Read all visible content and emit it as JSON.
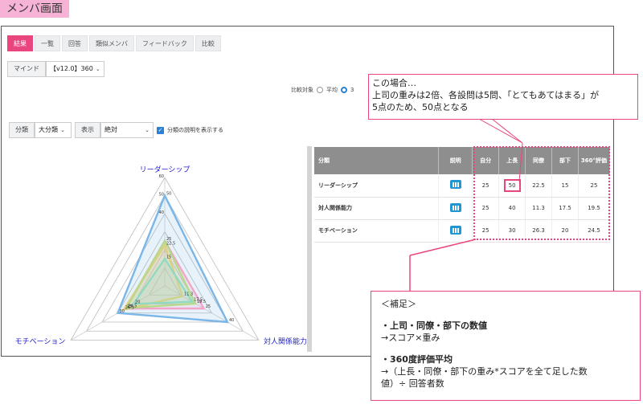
{
  "page_title": "メンバ画面",
  "tabs": [
    {
      "label": "結果",
      "active": true
    },
    {
      "label": "一覧",
      "active": false
    },
    {
      "label": "回答",
      "active": false
    },
    {
      "label": "類似メンバ",
      "active": false
    },
    {
      "label": "フィードバック",
      "active": false
    },
    {
      "label": "比較",
      "active": false
    }
  ],
  "mind": {
    "label": "マインド",
    "selected": "【v12.0】360"
  },
  "compare": {
    "label": "比較対象",
    "option1": "平均",
    "option2": "3"
  },
  "filter": {
    "category_label": "分類",
    "category_selected": "大分類",
    "display_label": "表示",
    "display_selected": "絶対",
    "checkbox_label": "分類の説明を表示する"
  },
  "chart_data": {
    "type": "radar",
    "axes": [
      "リーダーシップ",
      "対人関係能力",
      "モチベーション"
    ],
    "range": [
      0,
      60
    ],
    "ticks": [
      0,
      10,
      20,
      30,
      40,
      50,
      60
    ],
    "series": [
      {
        "name": "上長",
        "values": [
          50,
          40,
          30
        ],
        "color": "#7ab6e8"
      },
      {
        "name": "自分",
        "values": [
          25,
          25,
          25
        ],
        "color": "#f1a6c8"
      },
      {
        "name": "同僚",
        "values": [
          22.5,
          11.3,
          26.3
        ],
        "color": "#e8cf7d"
      },
      {
        "name": "部下",
        "values": [
          15,
          17.5,
          20
        ],
        "color": "#86dccd"
      },
      {
        "name": "360°評価",
        "values": [
          25,
          19.5,
          24.5
        ],
        "color": "#b7d98a"
      }
    ],
    "point_labels": [
      "60",
      "50",
      "40",
      "25",
      "22.5",
      "15",
      "1",
      "0",
      "11.3",
      "25",
      "11.5",
      "19.5",
      "40",
      "20",
      "26.3",
      "25",
      "24.5",
      "30"
    ]
  },
  "table": {
    "headers": [
      "分類",
      "説明",
      "自分",
      "上長",
      "同僚",
      "部下",
      "360°評価"
    ],
    "rows": [
      {
        "name": "リーダーシップ",
        "values": [
          "25",
          "50",
          "22.5",
          "15",
          "25"
        ]
      },
      {
        "name": "対人関係能力",
        "values": [
          "25",
          "40",
          "11.3",
          "17.5",
          "19.5"
        ]
      },
      {
        "name": "モチベーション",
        "values": [
          "25",
          "30",
          "26.3",
          "20",
          "24.5"
        ]
      }
    ]
  },
  "callout_top": {
    "line1": "この場合…",
    "line2": "上司の重みは2倍、各設問は5問、「とてもあてはまる」が",
    "line3": "5点のため、50点となる"
  },
  "callout_bottom": {
    "heading": "＜補足＞",
    "item1_title": "・上司・同僚・部下の数値",
    "item1_desc": "→スコア×重み",
    "item2_title": "・360度評価平均",
    "item2_desc1": "→（上長・同僚・部下の重み*スコアを全て足した数",
    "item2_desc2": "値）÷ 回答者数"
  }
}
